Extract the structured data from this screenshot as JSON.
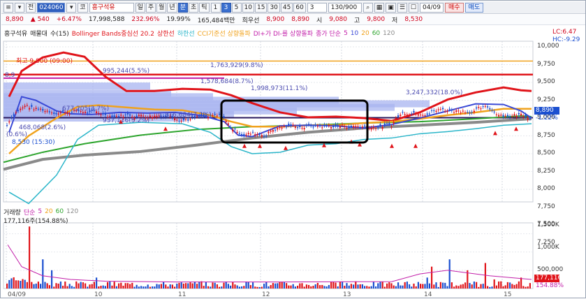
{
  "toolbar": {
    "menu_icon": "menu-icon",
    "dropdown_icon": "chevron-down-icon",
    "scope_label": "전",
    "stock_code": "024060",
    "code_prefix": "코",
    "stock_name": "흥구석유",
    "period_buttons": [
      "일",
      "주",
      "월",
      "년",
      "분",
      "초",
      "틱"
    ],
    "active_period": "분",
    "interval_buttons": [
      "1",
      "3",
      "5",
      "10",
      "15",
      "30",
      "45",
      "60"
    ],
    "active_interval": "3",
    "interval_value": "3",
    "count_field": "130/900",
    "date_field": "04/09",
    "buy_label": "매수",
    "sell_label": "매도"
  },
  "quote": {
    "price": "8,890",
    "change": "540",
    "change_rate": "+6.47%",
    "volume": "17,998,588",
    "volume_ratio": "232.96%",
    "turnover": "19.99%",
    "amount": "165,484백만",
    "warrant_label": "희우선",
    "open": "8,900",
    "open_alt": "8,890",
    "low_label": "시",
    "low": "9,080",
    "high_label": "고",
    "high": "9,800",
    "close_label": "저",
    "close": "8,530"
  },
  "legend": {
    "stock": "흥구석유",
    "trade_label": "매물대",
    "trade_count": "수(15)",
    "bollinger": "Bollinger Bands중심선 20.2",
    "upper": "상한선",
    "lower": "하한선",
    "cci": "CCI기준선 상향돌파",
    "dmi": "DI+가 DI-를 상향돌파",
    "ma_label": "종가 단순",
    "ma_periods": [
      "5",
      "10",
      "20",
      "60",
      "120"
    ],
    "lc": "LC:6.47",
    "hc": "HC:-9.29"
  },
  "price_scale": {
    "ticks": [
      "10,000",
      "9,750",
      "9,500",
      "9,250",
      "9,000",
      "8,750",
      "8,500",
      "8,250",
      "8,000",
      "7,750",
      "7,500",
      "7,250"
    ],
    "current": "8,890",
    "current_rate": "-1.22%",
    "current_color": "#1b4fd0"
  },
  "volume_scale": {
    "ticks": [
      "1,500K",
      "1,000K",
      "500,000"
    ],
    "current": "177,116",
    "current_rate": "154.88%"
  },
  "volume_legend": {
    "title": "거래량",
    "ma": "단순",
    "periods": [
      "5",
      "20",
      "60",
      "120"
    ],
    "value": "177,116주(154.88%)"
  },
  "annotations": {
    "high_marker": "최고 9,800 (09:00)",
    "pa": "995,244(5.5%)",
    "pb": "1,578,684(8.7%)",
    "pc": "1,998,973(11.1%)",
    "pd": "1,763,929(9.8%)",
    "pe": "3,247,332(18.0%)",
    "pf": "677,205(3.7%)",
    "pg": "1,316,684(7.3%)",
    "ph": "937,116(5.2%)",
    "pi": "468,068(2.6%)",
    "pj": "(0.6%)",
    "low_marker": "8,530 (15:30)",
    "left_val": "8,9"
  },
  "x_axis": {
    "ticks": [
      "04/09",
      "10",
      "11",
      "12",
      "13",
      "14",
      "15"
    ]
  },
  "colors": {
    "up": "#e0141a",
    "down": "#1b4fd0",
    "bollinger_upper": "#e0141a",
    "bollinger_lower": "#29b5c9",
    "ma5": "#3b4ad6",
    "ma20": "#f0a21c",
    "ma60": "#2ea52e",
    "ma120": "#8a8a8a",
    "volume_profile": "#a8b4f0",
    "highlight_box": "#000000"
  }
}
